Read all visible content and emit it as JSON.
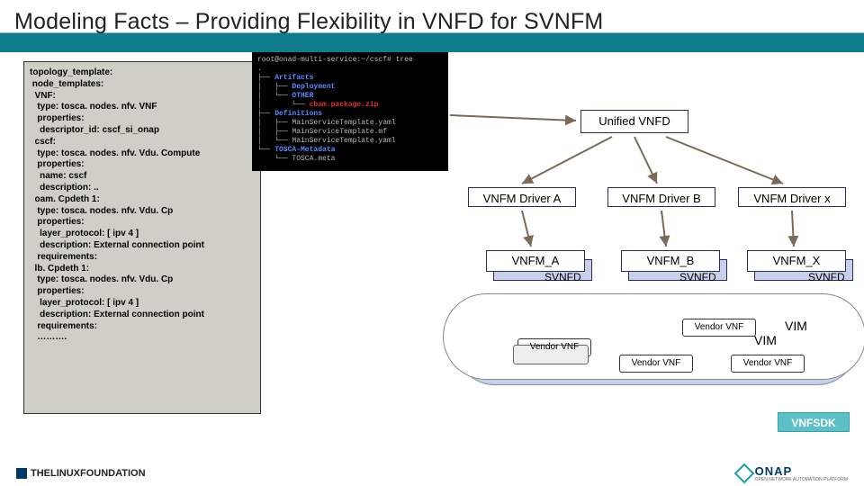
{
  "title": "Modeling Facts – Providing Flexibility in VNFD for SVNFM",
  "code": "topology_template:\n node_templates:\n  VNF:\n   type: tosca. nodes. nfv. VNF\n   properties:\n    descriptor_id: cscf_si_onap\n  cscf:\n   type: tosca. nodes. nfv. Vdu. Compute\n   properties:\n    name: cscf\n    description: ..\n  oam. Cpdeth 1:\n   type: tosca. nodes. nfv. Vdu. Cp\n   properties:\n    layer_protocol: [ ipv 4 ]\n    description: External connection point\n   requirements:\n  lb. Cpdeth 1:\n   type: tosca. nodes. nfv. Vdu. Cp\n   properties:\n    layer_protocol: [ ipv 4 ]\n    description: External connection point\n   requirements:\n   ……….",
  "terminal": {
    "l0": "root@onad-multi-service:~/cscf# tree",
    "l1": ".",
    "l2a": "├── ",
    "l2b": "Artifacts",
    "l3a": "│   ├── ",
    "l3b": "Deployment",
    "l4a": "│   └── ",
    "l4b": "OTHER",
    "l5a": "│       └── ",
    "l5b": "cbam.package.zip",
    "l6a": "├── ",
    "l6b": "Definitions",
    "l7a": "│   ├── ",
    "l7b": "MainServiceTemplate.yaml",
    "l8a": "│   ├── ",
    "l8b": "MainServiceTemplate.mf",
    "l9a": "│   └── ",
    "l9b": "MainServiceTemplate.yaml",
    "l10a": "└── ",
    "l10b": "TOSCA-Metadata",
    "l11a": "    └── ",
    "l11b": "TOSCA.meta"
  },
  "nodes": {
    "unified": "Unified VNFD",
    "driver_a": "VNFM Driver A",
    "driver_b": "VNFM Driver B",
    "driver_x": "VNFM Driver x",
    "vnfm_a": "VNFM_A",
    "vnfm_b": "VNFM_B",
    "vnfm_x": "VNFM_X",
    "svnfd": "SVNFD",
    "vendor_vnf": "Vendor VNF",
    "vim": "VIM",
    "vnfsdk": "VNFSDK"
  },
  "footer": {
    "linux_the": "THE",
    "linux_lf": "LINUX FOUNDATION",
    "onap": "ONAP",
    "onap_sub": "OPEN NETWORK AUTOMATION PLATFORM"
  }
}
